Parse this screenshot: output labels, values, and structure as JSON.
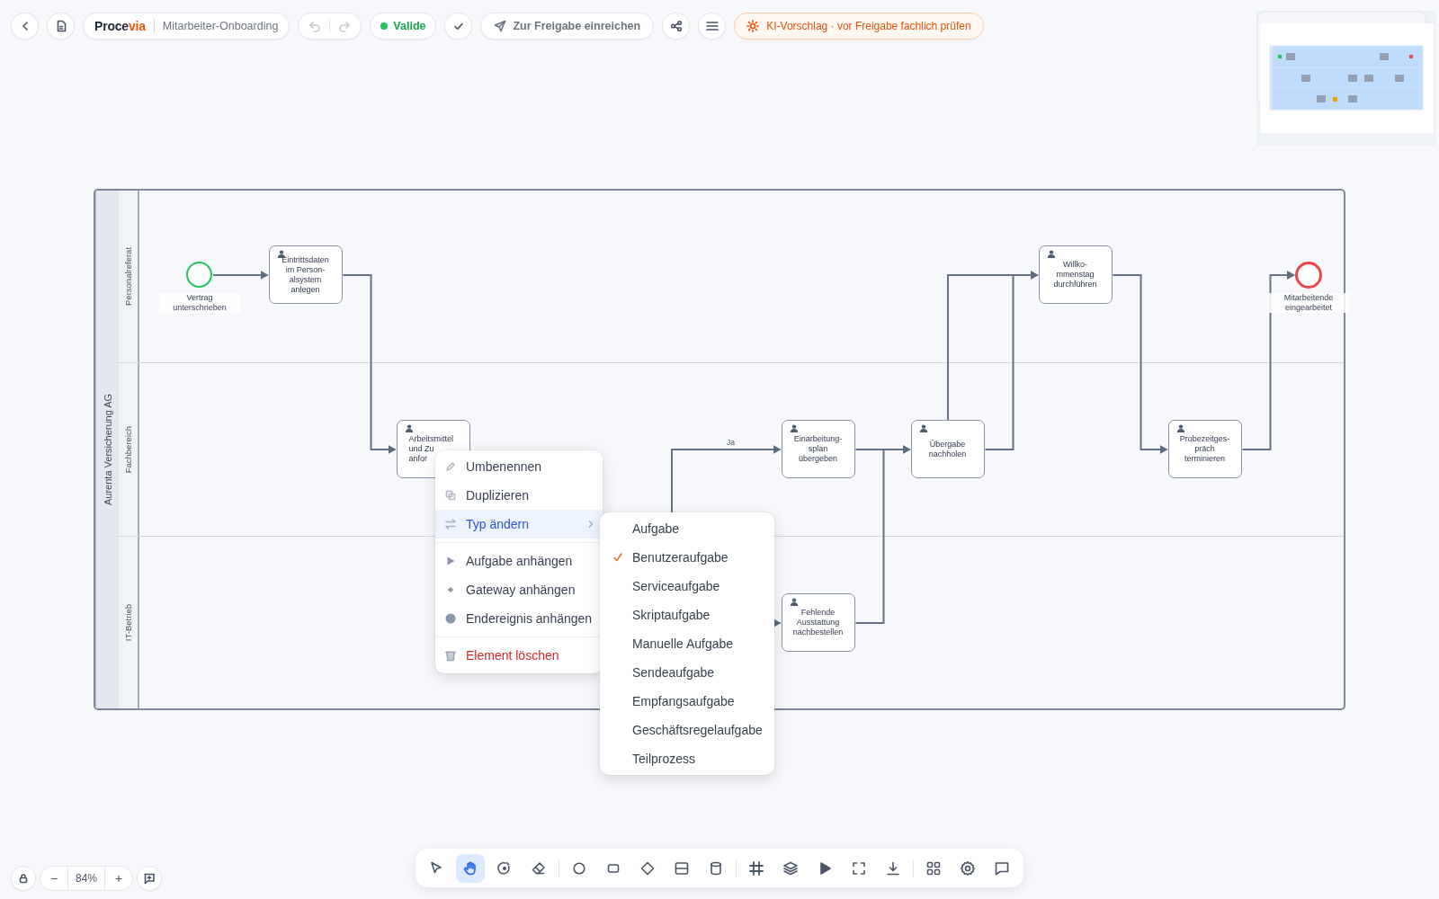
{
  "topbar": {
    "logo": {
      "main": "Proce",
      "accent": "via"
    },
    "document_title": "Mitarbeiter-Onboarding",
    "history": {
      "undo_enabled": false,
      "redo_enabled": false
    },
    "validation": {
      "label": "Valide",
      "valid": true
    },
    "submit": {
      "label": "Zur Freigabe einreichen"
    },
    "ai_hint": {
      "label": "KI-Vorschlag · vor Freigabe fachlich prüfen"
    }
  },
  "diagram": {
    "pool": "Aurenta Versicherung AG",
    "lanes": [
      {
        "name": "Personalreferat",
        "elements": [
          {
            "kind": "start_event",
            "label": "Vertrag\nunterschrieben"
          },
          {
            "kind": "user_task",
            "label": "Eintrittsdaten\nim Person-\nalsystem\nanlegen",
            "partly_hidden": false
          },
          {
            "kind": "user_task",
            "label": "Willko-\nmmenstag\ndurchführen",
            "partly_hidden": false
          },
          {
            "kind": "end_event",
            "label": "Mitarbeitende\neingearbeitet"
          }
        ]
      },
      {
        "name": "Fachbereich",
        "elements": [
          {
            "kind": "user_task",
            "label": "Arbeitsmittel\nund Zu\nanfor",
            "partly_hidden": true
          },
          {
            "kind": "user_task",
            "label": "Einarbeitung-\nsplan\nübergeben",
            "partly_hidden": false
          },
          {
            "kind": "user_task",
            "label": "Übergabe\nnachholen",
            "partly_hidden": false
          },
          {
            "kind": "user_task",
            "label": "Probezeitges-\npräch\nterminieren",
            "partly_hidden": false
          }
        ]
      },
      {
        "name": "IT-Betrieb",
        "elements": [
          {
            "kind": "user_task",
            "label": "Fehlende\nAusstattung\nnachbestellen",
            "partly_hidden": false
          }
        ]
      }
    ],
    "flow_labels": [
      "Ja"
    ]
  },
  "context_menu": {
    "groups": [
      [
        {
          "kind": "rename",
          "label": "Umbenennen",
          "highlighted": false
        },
        {
          "kind": "duplicate",
          "label": "Duplizieren",
          "highlighted": false
        },
        {
          "kind": "change_type",
          "label": "Typ ändern",
          "highlighted": true
        }
      ],
      [
        {
          "kind": "append_task",
          "label": "Aufgabe anhängen",
          "highlighted": false
        },
        {
          "kind": "append_gateway",
          "label": "Gateway anhängen",
          "highlighted": false
        },
        {
          "kind": "append_end",
          "label": "Endereignis anhängen",
          "highlighted": false
        }
      ],
      [
        {
          "kind": "delete",
          "label": "Element löschen",
          "highlighted": false
        }
      ]
    ]
  },
  "type_submenu": {
    "items": [
      {
        "label": "Aufgabe",
        "checked": false
      },
      {
        "label": "Benutzeraufgabe",
        "checked": true
      },
      {
        "label": "Serviceaufgabe",
        "checked": false
      },
      {
        "label": "Skriptaufgabe",
        "checked": false
      },
      {
        "label": "Manuelle Aufgabe",
        "checked": false
      },
      {
        "label": "Sendeaufgabe",
        "checked": false
      },
      {
        "label": "Empfangsaufgabe",
        "checked": false
      },
      {
        "label": "Geschäftsregelaufgabe",
        "checked": false
      },
      {
        "label": "Teilprozess",
        "checked": false
      }
    ]
  },
  "zoom_controls": {
    "minus": "−",
    "value": "84%",
    "plus": "+"
  },
  "toolbar": {
    "groups": [
      [
        {
          "kind": "select",
          "selected": false
        },
        {
          "kind": "hand",
          "selected": true
        },
        {
          "kind": "lasso",
          "selected": false
        },
        {
          "kind": "eraser",
          "selected": false
        }
      ],
      [
        {
          "kind": "circle",
          "selected": false
        },
        {
          "kind": "rectangle",
          "selected": false
        },
        {
          "kind": "diamond",
          "selected": false
        },
        {
          "kind": "lane",
          "selected": false
        },
        {
          "kind": "datastore",
          "selected": false
        }
      ],
      [
        {
          "kind": "grid",
          "selected": false
        },
        {
          "kind": "layers",
          "selected": false
        },
        {
          "kind": "play",
          "selected": false
        },
        {
          "kind": "fullscreen",
          "selected": false
        },
        {
          "kind": "download",
          "selected": false
        }
      ],
      [
        {
          "kind": "apps",
          "selected": false
        },
        {
          "kind": "settings",
          "selected": false
        },
        {
          "kind": "comments",
          "selected": false
        }
      ]
    ]
  }
}
